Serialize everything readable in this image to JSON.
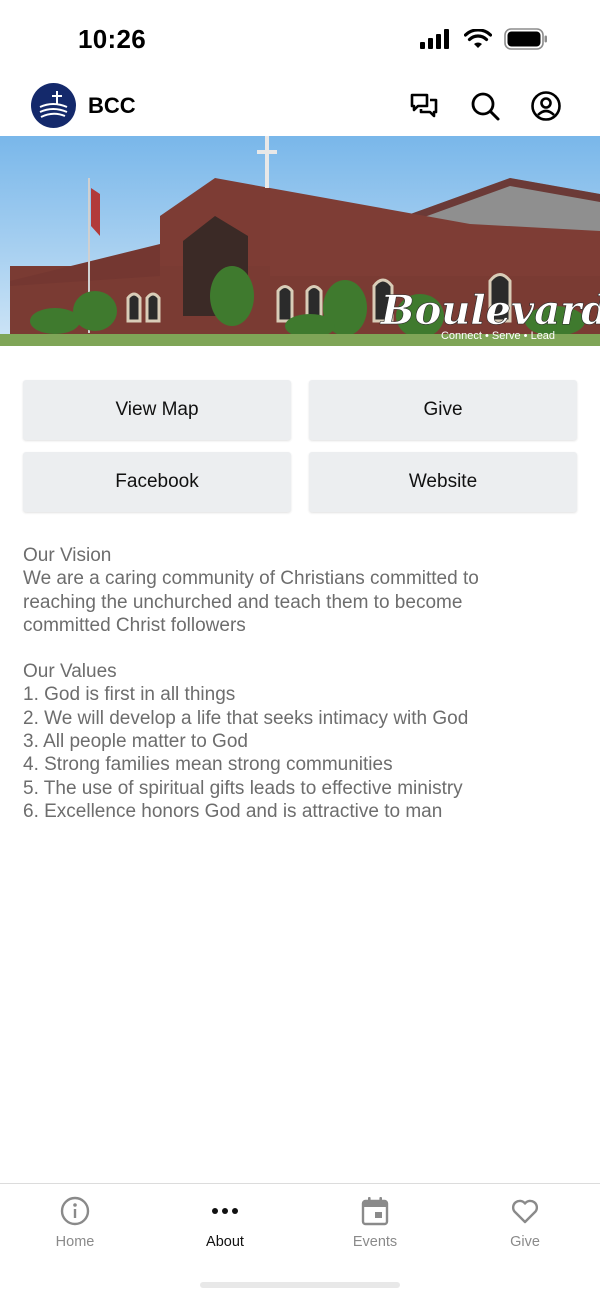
{
  "status": {
    "time": "10:26"
  },
  "header": {
    "title": "BCC"
  },
  "hero": {
    "script_text": "Boulevard",
    "tagline": "Connect • Serve • Lead"
  },
  "buttons": [
    {
      "label": "View Map"
    },
    {
      "label": "Give"
    },
    {
      "label": "Facebook"
    },
    {
      "label": "Website"
    }
  ],
  "about": {
    "vision_heading": "Our Vision",
    "vision_line1": "We are a caring community of Christians committed to",
    "vision_line2": "reaching the unchurched and teach them to become",
    "vision_line3": "committed Christ followers",
    "values_heading": "Our Values",
    "values": [
      "1. God is first in all things",
      "2. We will develop a life that seeks intimacy with God",
      "3. All people matter to God",
      "4. Strong families mean strong communities",
      "5. The use of spiritual gifts leads to effective ministry",
      "6. Excellence honors God and is attractive to man"
    ]
  },
  "tabs": [
    {
      "label": "Home",
      "icon": "info-icon"
    },
    {
      "label": "About",
      "icon": "more-dots-icon",
      "active": true
    },
    {
      "label": "Events",
      "icon": "calendar-icon"
    },
    {
      "label": "Give",
      "icon": "heart-icon"
    }
  ],
  "colors": {
    "logo_bg": "#14296b",
    "button_bg": "#eceef0",
    "body_text": "#6d6d6d",
    "tab_inactive": "#8a8a8a"
  }
}
